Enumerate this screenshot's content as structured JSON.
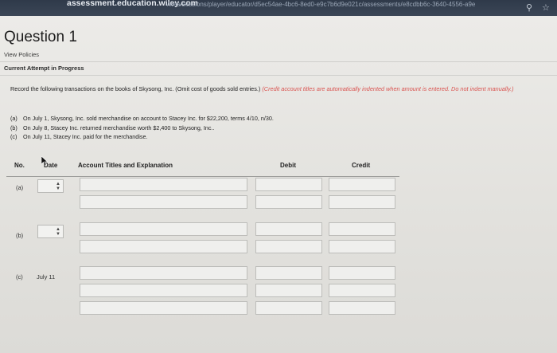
{
  "browser": {
    "url": "assessment.education.wiley.com",
    "url_rest": "/was/sessions/player/educator/d5ec54ae-4bc6-8ed0-e9c7b6d9e021c/assessments/e8cdbb6c-3640-4556-a9e"
  },
  "question": {
    "title": "Question 1",
    "view_policies": "View Policies",
    "attempt_status": "Current Attempt in Progress"
  },
  "instruction": {
    "text": "Record the following transactions on the books of Skysong, Inc. (Omit cost of goods sold entries.)",
    "note": "(Credit account titles are automatically indented when amount is entered. Do not indent manually.)"
  },
  "transactions": [
    {
      "label": "(a)",
      "text": "On July 1, Skysong, Inc. sold merchandise on account to Stacey Inc. for $22,200, terms 4/10, n/30."
    },
    {
      "label": "(b)",
      "text": "On July 8, Stacey Inc. returned merchandise worth $2,400 to Skysong, Inc.."
    },
    {
      "label": "(c)",
      "text": "On July 11, Stacey Inc. paid for the merchandise."
    }
  ],
  "table": {
    "headers": {
      "no": "No.",
      "date": "Date",
      "account": "Account Titles and Explanation",
      "debit": "Debit",
      "credit": "Credit"
    },
    "entries": [
      {
        "no": "(a)",
        "date": ""
      },
      {
        "no": "(b)",
        "date": ""
      },
      {
        "no": "(c)",
        "date": "July 11"
      }
    ]
  }
}
